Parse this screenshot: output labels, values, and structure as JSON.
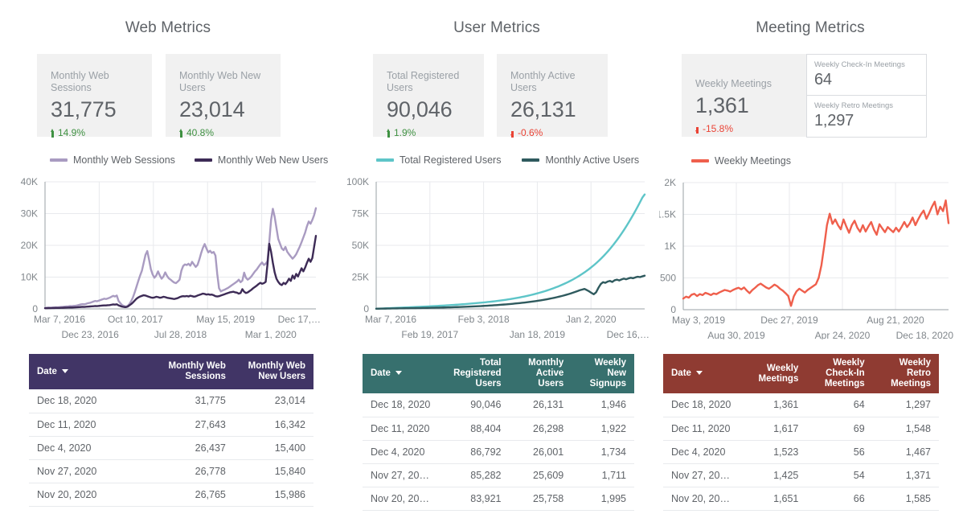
{
  "columns": [
    {
      "id": "web",
      "title": "Web Metrics",
      "kpis": [
        {
          "label": "Monthly Web Sessions",
          "value": "31,775",
          "delta": "14.9%",
          "direction": "up"
        },
        {
          "label": "Monthly Web New Users",
          "value": "23,014",
          "delta": "40.8%",
          "direction": "up"
        }
      ],
      "legend": [
        {
          "label": "Monthly Web Sessions",
          "color": "#a99bc1"
        },
        {
          "label": "Monthly Web New Users",
          "color": "#3d2b56"
        }
      ],
      "table": {
        "headers": [
          "Date",
          "Monthly Web Sessions",
          "Monthly Web New Users"
        ],
        "sort_column": "Date",
        "header_color": "#413566",
        "rows": [
          [
            "Dec 18, 2020",
            "31,775",
            "23,014"
          ],
          [
            "Dec 11, 2020",
            "27,643",
            "16,342"
          ],
          [
            "Dec 4, 2020",
            "26,437",
            "15,400"
          ],
          [
            "Nov 27, 2020",
            "26,778",
            "15,840"
          ],
          [
            "Nov 20, 2020",
            "26,765",
            "15,986"
          ]
        ]
      }
    },
    {
      "id": "user",
      "title": "User Metrics",
      "kpis": [
        {
          "label": "Total Registered Users",
          "value": "90,046",
          "delta": "1.9%",
          "direction": "up"
        },
        {
          "label": "Monthly Active Users",
          "value": "26,131",
          "delta": "-0.6%",
          "direction": "down"
        }
      ],
      "legend": [
        {
          "label": "Total Registered Users",
          "color": "#5ec5c8"
        },
        {
          "label": "Monthly Active Users",
          "color": "#2f5a5e"
        }
      ],
      "table": {
        "headers": [
          "Date",
          "Total Registered Users",
          "Monthly Active Users",
          "Weekly New Signups"
        ],
        "sort_column": "Date",
        "header_color": "#37706e",
        "rows": [
          [
            "Dec 18, 2020",
            "90,046",
            "26,131",
            "1,946"
          ],
          [
            "Dec 11, 2020",
            "88,404",
            "26,298",
            "1,922"
          ],
          [
            "Dec 4, 2020",
            "86,792",
            "26,001",
            "1,734"
          ],
          [
            "Nov 27, 20…",
            "85,282",
            "25,609",
            "1,711"
          ],
          [
            "Nov 20, 20…",
            "83,921",
            "25,758",
            "1,995"
          ]
        ]
      }
    },
    {
      "id": "meeting",
      "title": "Meeting Metrics",
      "kpis": [
        {
          "label": "Weekly Meetings",
          "value": "1,361",
          "delta": "-15.8%",
          "direction": "down"
        }
      ],
      "mini_kpis": [
        {
          "label": "Weekly Check-In Meetings",
          "value": "64"
        },
        {
          "label": "Weekly Retro Meetings",
          "value": "1,297"
        }
      ],
      "legend": [
        {
          "label": "Weekly Meetings",
          "color": "#ef5f4c"
        }
      ],
      "table": {
        "headers": [
          "Date",
          "Weekly Meetings",
          "Weekly Check-In Meetings",
          "Weekly Retro Meetings"
        ],
        "sort_column": "Date",
        "header_color": "#8f3b32",
        "rows": [
          [
            "Dec 18, 2020",
            "1,361",
            "64",
            "1,297"
          ],
          [
            "Dec 11, 2020",
            "1,617",
            "69",
            "1,548"
          ],
          [
            "Dec 4, 2020",
            "1,523",
            "56",
            "1,467"
          ],
          [
            "Nov 27, 20…",
            "1,425",
            "54",
            "1,371"
          ],
          [
            "Nov 20, 20…",
            "1,651",
            "66",
            "1,585"
          ]
        ]
      }
    }
  ],
  "chart_data": [
    {
      "type": "line",
      "title": "Web Metrics",
      "xlabel": "",
      "ylabel": "",
      "ylim": [
        0,
        40000
      ],
      "yticks": [
        "0",
        "10K",
        "20K",
        "30K",
        "40K"
      ],
      "xticks_top": [
        "Mar 7, 2016",
        "Oct 10, 2017",
        "May 15, 2019",
        "Dec 17,…"
      ],
      "xticks_bottom": [
        "Dec 23, 2016",
        "Jul 28, 2018",
        "Mar 1, 2020"
      ],
      "grid": true,
      "legend_position": "top-left",
      "series": [
        {
          "name": "Monthly Web Sessions",
          "color": "#a99bc1",
          "values": [
            300,
            350,
            400,
            380,
            420,
            500,
            520,
            480,
            560,
            600,
            640,
            700,
            760,
            820,
            900,
            880,
            950,
            1000,
            1100,
            1250,
            1400,
            1500,
            1450,
            1600,
            1800,
            1900,
            2100,
            2300,
            2500,
            2400,
            2600,
            2800,
            3000,
            3200,
            3100,
            3300,
            3500,
            3800,
            4100,
            3900,
            4200,
            2500,
            1800,
            1200,
            900,
            700,
            900,
            1500,
            2400,
            3600,
            5200,
            7000,
            8800,
            10500,
            12000,
            14500,
            17000,
            18200,
            15500,
            12500,
            10800,
            9800,
            10500,
            11800,
            10500,
            9500,
            10200,
            11500,
            10400,
            9600,
            9200,
            8700,
            8300,
            8100,
            8600,
            9200,
            12000,
            13500,
            14000,
            13800,
            14200,
            13600,
            14800,
            14000,
            13200,
            13800,
            15500,
            17500,
            19200,
            20400,
            19000,
            17800,
            18300,
            17600,
            17900,
            16800,
            11000,
            6500,
            5500,
            5800,
            6000,
            6300,
            6600,
            7000,
            7400,
            7800,
            8200,
            8600,
            9200,
            8400,
            8900,
            11400,
            9800,
            9200,
            9600,
            10200,
            11000,
            11800,
            12400,
            13200,
            14000,
            14600,
            13800,
            14200,
            15000,
            21000,
            28000,
            31500,
            29000,
            25500,
            22000,
            20500,
            19000,
            18500,
            19500,
            18000,
            17200,
            16500,
            15800,
            16400,
            17200,
            18400,
            19600,
            21000,
            22500,
            24000,
            26000,
            27500,
            26800,
            28000,
            29500,
            31700
          ]
        },
        {
          "name": "Monthly Web New Users",
          "color": "#3d2b56",
          "values": [
            200,
            220,
            250,
            240,
            260,
            280,
            300,
            290,
            310,
            330,
            350,
            380,
            400,
            420,
            450,
            440,
            470,
            490,
            520,
            560,
            600,
            640,
            620,
            680,
            720,
            760,
            800,
            850,
            900,
            880,
            940,
            1000,
            1050,
            1100,
            1080,
            1150,
            1200,
            1300,
            1400,
            1350,
            1450,
            1100,
            900,
            700,
            600,
            550,
            700,
            1100,
            1500,
            2000,
            2600,
            3200,
            3600,
            3900,
            4100,
            4300,
            4200,
            4000,
            3800,
            3600,
            3500,
            3600,
            3800,
            3700,
            3500,
            3600,
            3800,
            3700,
            3500,
            3400,
            3300,
            3200,
            3100,
            3250,
            3400,
            3700,
            3900,
            4000,
            3950,
            4050,
            3900,
            4150,
            4000,
            3850,
            3950,
            4200,
            4400,
            4600,
            4800,
            4700,
            4500,
            4600,
            4450,
            4500,
            4300,
            4000,
            3900,
            4000,
            4200,
            4400,
            4600,
            4800,
            5000,
            5200,
            5300,
            5400,
            5200,
            5100,
            4800,
            5000,
            6200,
            5400,
            5000,
            5200,
            5600,
            6000,
            6500,
            6900,
            7300,
            7800,
            8200,
            7900,
            8100,
            8500,
            14000,
            20500,
            18000,
            14500,
            11500,
            9500,
            8500,
            7800,
            7500,
            8200,
            7800,
            8500,
            9500,
            8800,
            10500,
            9500,
            11000,
            10200,
            11500,
            12800,
            11800,
            13000,
            14500,
            15800,
            14800,
            16000,
            19500,
            23000
          ]
        }
      ]
    },
    {
      "type": "line",
      "title": "User Metrics",
      "xlabel": "",
      "ylabel": "",
      "ylim": [
        0,
        100000
      ],
      "yticks": [
        "0",
        "25K",
        "50K",
        "75K",
        "100K"
      ],
      "xticks_top": [
        "Mar 7, 2016",
        "Feb 3, 2018",
        "Jan 2, 2020"
      ],
      "xticks_bottom": [
        "Feb 19, 2017",
        "Jan 18, 2019",
        "Dec 16,…"
      ],
      "grid": true,
      "legend_position": "top-left",
      "series": [
        {
          "name": "Total Registered Users",
          "color": "#5ec5c8",
          "values": [
            150,
            200,
            260,
            330,
            400,
            480,
            560,
            640,
            720,
            800,
            880,
            960,
            1040,
            1120,
            1200,
            1280,
            1360,
            1440,
            1520,
            1600,
            1690,
            1780,
            1870,
            1960,
            2050,
            2150,
            2250,
            2350,
            2450,
            2560,
            2670,
            2780,
            2890,
            3010,
            3130,
            3250,
            3380,
            3510,
            3640,
            3780,
            3920,
            4060,
            4210,
            4360,
            4520,
            4680,
            4850,
            5020,
            5200,
            5390,
            5580,
            5780,
            5990,
            6210,
            6440,
            6680,
            6930,
            7190,
            7460,
            7740,
            8030,
            8340,
            8660,
            9000,
            9350,
            9720,
            10100,
            10500,
            10920,
            11360,
            11820,
            12300,
            12800,
            13320,
            13870,
            14440,
            15030,
            15650,
            16300,
            16980,
            17680,
            18420,
            19200,
            20010,
            20860,
            21750,
            22680,
            23660,
            24680,
            25750,
            26880,
            28060,
            29300,
            30600,
            31970,
            33400,
            34900,
            36480,
            38130,
            39870,
            41690,
            43600,
            45600,
            47700,
            49900,
            52200,
            54600,
            57100,
            59700,
            62400,
            65200,
            68100,
            71100,
            74200,
            77400,
            80700,
            84100,
            87600,
            90046
          ]
        },
        {
          "name": "Monthly Active Users",
          "color": "#2f5a5e",
          "values": [
            120,
            150,
            180,
            210,
            240,
            270,
            300,
            330,
            360,
            390,
            420,
            450,
            480,
            510,
            540,
            570,
            600,
            630,
            660,
            690,
            720,
            760,
            800,
            840,
            880,
            920,
            960,
            1000,
            1050,
            1100,
            1150,
            1200,
            1250,
            1300,
            1360,
            1420,
            1480,
            1540,
            1600,
            1680,
            1760,
            1840,
            1920,
            2000,
            2100,
            2200,
            2300,
            2400,
            2500,
            2620,
            2740,
            2860,
            2980,
            3120,
            3260,
            3400,
            3550,
            3700,
            3860,
            4020,
            4200,
            4380,
            4560,
            4760,
            4960,
            5180,
            5400,
            5640,
            5880,
            6150,
            6420,
            6710,
            7000,
            7320,
            7650,
            8000,
            8380,
            8760,
            9170,
            9600,
            10050,
            10520,
            11030,
            11560,
            12120,
            12720,
            13340,
            14000,
            14700,
            15200,
            15700,
            14800,
            13800,
            12600,
            11500,
            13000,
            16500,
            19500,
            21000,
            20500,
            21500,
            22000,
            21200,
            22500,
            23000,
            22400,
            23200,
            23800,
            23300,
            24000,
            24500,
            24100,
            24800,
            25300,
            25000,
            25600,
            26131
          ]
        }
      ]
    },
    {
      "type": "line",
      "title": "Meeting Metrics",
      "xlabel": "",
      "ylabel": "",
      "ylim": [
        0,
        2000
      ],
      "yticks": [
        "0",
        "500",
        "1K",
        "1.5K",
        "2K"
      ],
      "xticks_top": [
        "May 3, 2019",
        "Dec 27, 2019",
        "Aug 21, 2020"
      ],
      "xticks_bottom": [
        "Aug 30, 2019",
        "Apr 24, 2020",
        "Dec 18, 2020"
      ],
      "grid": true,
      "legend_position": "top-left",
      "series": [
        {
          "name": "Weekly Meetings",
          "color": "#ef5f4c",
          "values": [
            175,
            205,
            190,
            235,
            250,
            215,
            245,
            230,
            265,
            250,
            230,
            255,
            245,
            270,
            290,
            310,
            300,
            285,
            310,
            330,
            345,
            320,
            350,
            300,
            260,
            310,
            345,
            385,
            410,
            380,
            350,
            330,
            360,
            395,
            370,
            330,
            300,
            260,
            215,
            60,
            210,
            290,
            330,
            300,
            270,
            310,
            340,
            370,
            400,
            500,
            700,
            1000,
            1330,
            1510,
            1350,
            1420,
            1330,
            1265,
            1420,
            1310,
            1210,
            1330,
            1400,
            1290,
            1225,
            1330,
            1230,
            1310,
            1380,
            1260,
            1180,
            1345,
            1280,
            1220,
            1300,
            1260,
            1220,
            1290,
            1230,
            1300,
            1380,
            1300,
            1360,
            1450,
            1330,
            1420,
            1500,
            1560,
            1430,
            1520,
            1620,
            1700,
            1500,
            1620,
            1550,
            1720,
            1361
          ]
        }
      ]
    }
  ]
}
